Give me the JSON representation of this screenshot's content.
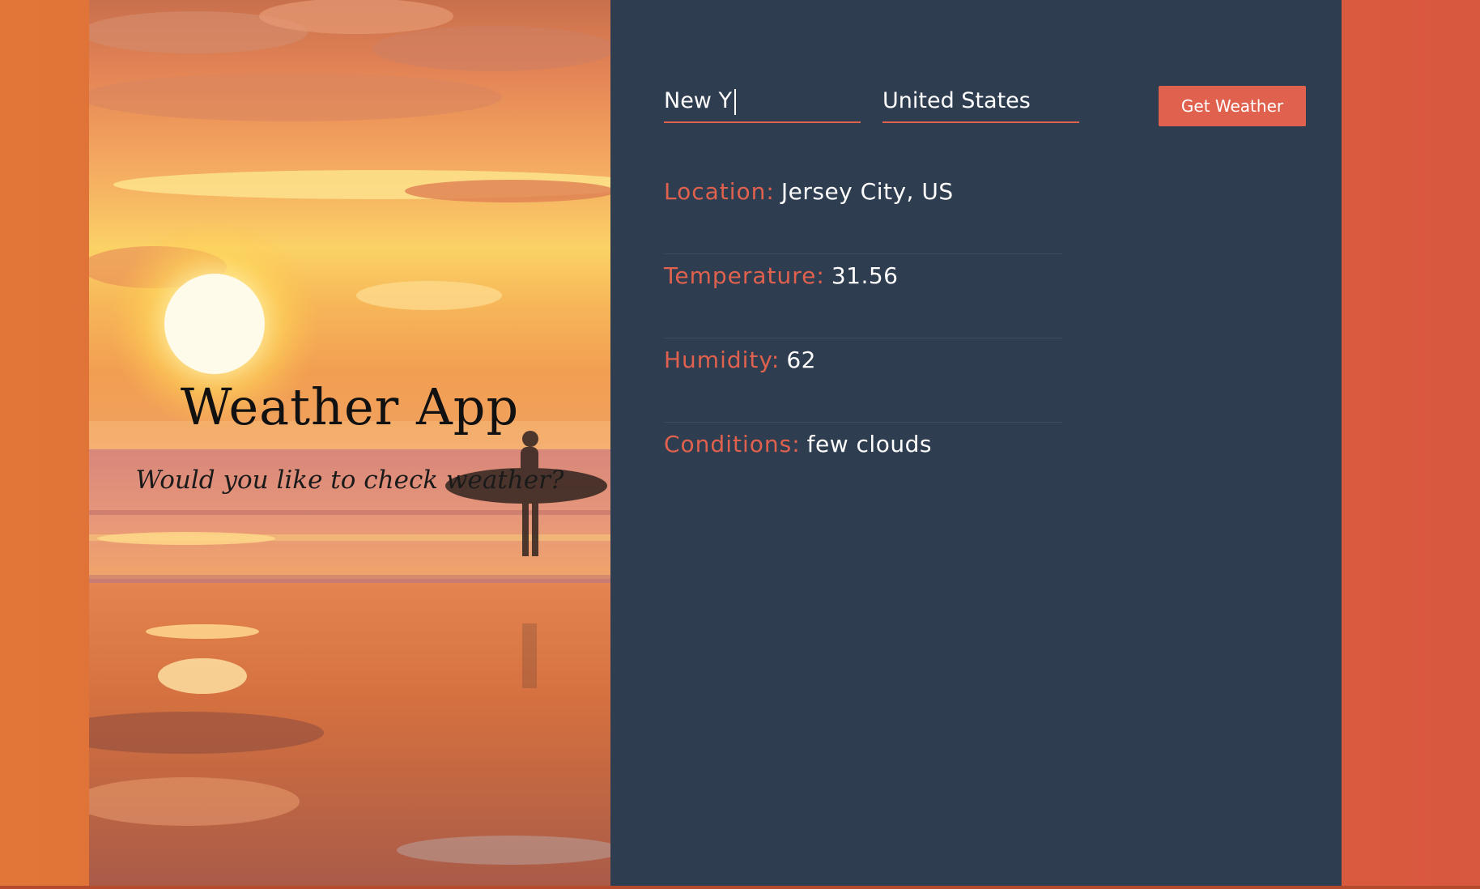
{
  "hero": {
    "title": "Weather App",
    "subtitle": "Would you like to check weather?"
  },
  "form": {
    "city_value": "New Y",
    "country_value": "United States",
    "submit_label": "Get Weather"
  },
  "results": {
    "location": {
      "label": "Location:",
      "value": "Jersey City, US"
    },
    "temperature": {
      "label": "Temperature:",
      "value": "31.56"
    },
    "humidity": {
      "label": "Humidity:",
      "value": "62"
    },
    "conditions": {
      "label": "Conditions:",
      "value": "few clouds"
    }
  },
  "colors": {
    "accent": "#e0614d",
    "panel_bg": "#2f3d51",
    "page_bg_left": "#e07638",
    "page_bg_right": "#d8573f"
  }
}
